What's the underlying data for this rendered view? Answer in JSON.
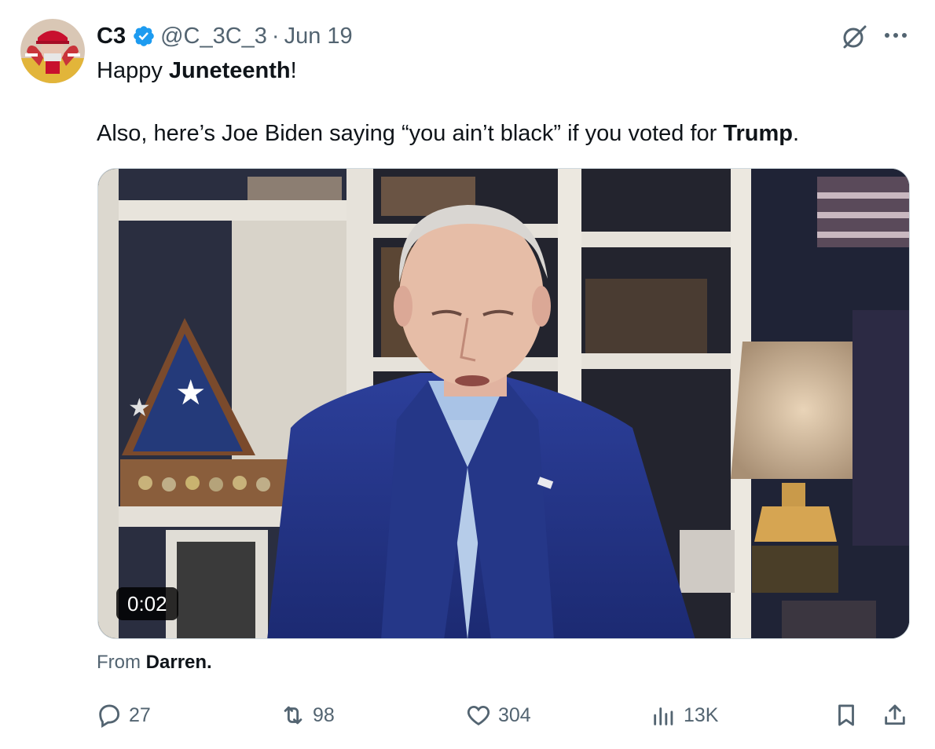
{
  "tweet": {
    "display_name": "C3",
    "handle": "@C_3C_3",
    "separator": "·",
    "date": "Jun 19",
    "line1_prefix": "Happy ",
    "line1_bold": "Juneteenth",
    "line1_suffix": "!",
    "line2_prefix": "Also, here’s Joe Biden saying “you ain’t black” if you voted for ",
    "line2_bold": "Trump",
    "line2_suffix": "."
  },
  "media": {
    "duration": "0:02"
  },
  "source": {
    "prefix": "From ",
    "name": "Darren."
  },
  "actions": {
    "replies": "27",
    "reposts": "98",
    "likes": "304",
    "views": "13K"
  },
  "icons": {
    "verified": "verified-badge-icon",
    "grok": "grok-icon",
    "more": "more-icon",
    "reply": "reply-icon",
    "repost": "repost-icon",
    "like": "heart-icon",
    "views": "views-icon",
    "bookmark": "bookmark-icon",
    "share": "share-icon"
  },
  "colors": {
    "text": "#0f1419",
    "secondary": "#536471",
    "verified": "#1d9bf0",
    "border": "#cfd9de"
  }
}
